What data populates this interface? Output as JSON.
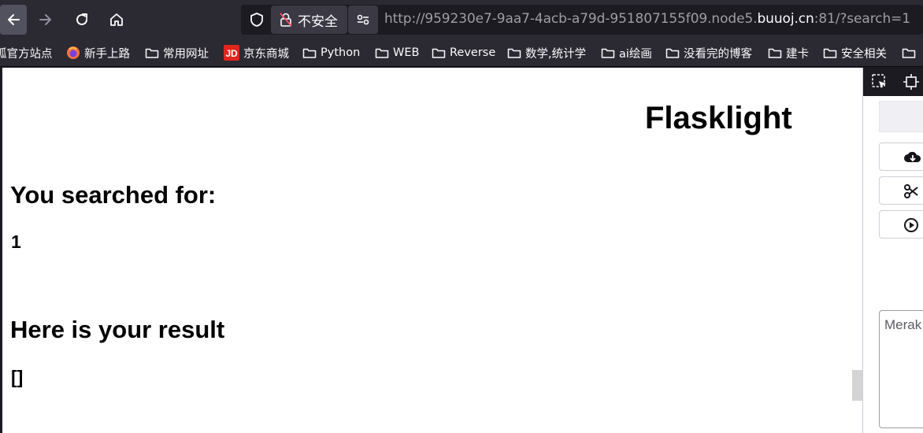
{
  "browser": {
    "security_label": "不安全",
    "url_prefix": "http://959230e7-9aa7-4acb-a79d-951807155f09.node5.",
    "url_host": "buuoj.cn",
    "url_suffix": ":81/?search=1"
  },
  "bookmarks": [
    {
      "label": "狐官方站点",
      "icon": "partial-icon"
    },
    {
      "label": "新手上路",
      "icon": "firefox-icon"
    },
    {
      "label": "常用网址",
      "icon": "folder-icon"
    },
    {
      "label": "京东商城",
      "icon": "jd-icon"
    },
    {
      "label": "Python",
      "icon": "folder-icon"
    },
    {
      "label": "WEB",
      "icon": "folder-icon"
    },
    {
      "label": "Reverse",
      "icon": "folder-icon"
    },
    {
      "label": "数学,统计学",
      "icon": "folder-icon"
    },
    {
      "label": "ai绘画",
      "icon": "folder-icon"
    },
    {
      "label": "没看完的博客",
      "icon": "folder-icon"
    },
    {
      "label": "建卡",
      "icon": "folder-icon"
    },
    {
      "label": "安全相关",
      "icon": "folder-icon"
    }
  ],
  "page": {
    "title": "Flasklight",
    "searched_heading": "You searched for:",
    "search_value": "1",
    "result_heading": "Here is your result",
    "result_value": "[]"
  },
  "side_panel": {
    "textarea_text": "Merak"
  },
  "colors": {
    "toolbar_bg": "#2b2a33",
    "url_bg": "#1c1b22",
    "page_bg": "#ffffff",
    "jd_red": "#e1251b"
  }
}
